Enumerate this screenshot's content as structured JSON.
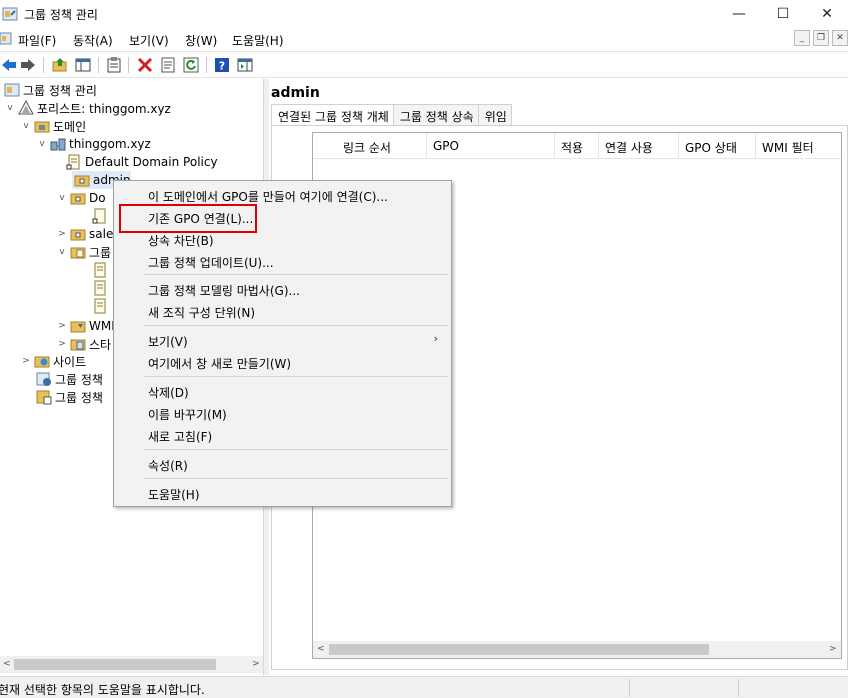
{
  "window": {
    "title": "그룹 정책 관리",
    "minimize": "—",
    "maximize": "☐",
    "close": "✕"
  },
  "menubar": {
    "items": [
      "파일(F)",
      "동작(A)",
      "보기(V)",
      "창(W)",
      "도움말(H)"
    ]
  },
  "toolbar": {
    "icons": [
      "back-icon",
      "forward-icon",
      "up-folder-icon",
      "show-hide-tree-icon",
      "clipboard-icon",
      "delete-icon",
      "properties-icon",
      "refresh-icon",
      "help-icon",
      "action-pane-icon"
    ],
    "accent_blue": "#1f6fd0",
    "delete_red": "#d32020"
  },
  "tree": {
    "root": "그룹 정책 관리",
    "forest": "포리스트: thinggom.xyz",
    "domains": "도메인",
    "domain": "thinggom.xyz",
    "default_policy": "Default Domain Policy",
    "admin_ou": "admin",
    "dom_ou_partial": "Do",
    "sales_partial": "sale",
    "group_partial": "그룹",
    "wmi_partial": "WMI",
    "starter_partial": "스타",
    "sites": "사이트",
    "modeling": "그룹 정책",
    "results": "그룹 정책"
  },
  "right": {
    "header": "admin",
    "tabs": [
      "연결된 그룹 정책 개체",
      "그룹 정책 상속",
      "위임"
    ],
    "columns": [
      "링크 순서",
      "GPO",
      "적용",
      "연결 사용",
      "GPO 상태",
      "WMI 필터"
    ]
  },
  "context_menu": {
    "items": [
      "이 도메인에서 GPO를 만들어 여기에 연결(C)...",
      "기존 GPO 연결(L)...",
      "상속 차단(B)",
      "그룹 정책 업데이트(U)...",
      "그룹 정책 모델링 마법사(G)...",
      "새 조직 구성 단위(N)",
      "보기(V)",
      "여기에서 창 새로 만들기(W)",
      "삭제(D)",
      "이름 바꾸기(M)",
      "새로 고침(F)",
      "속성(R)",
      "도움말(H)"
    ],
    "submenu_arrow": "›",
    "highlight_color": "#e00000"
  },
  "statusbar": {
    "text": "현재 선택한 항목의 도움말을 표시합니다."
  }
}
